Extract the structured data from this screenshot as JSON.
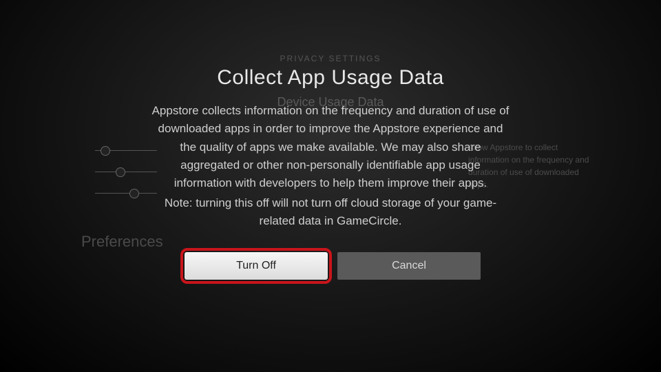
{
  "background": {
    "breadcrumb": "PRIVACY SETTINGS",
    "section_title": "Device Usage Data",
    "menu_label": "Preferences",
    "side_description": "Allow Appstore to collect information on the frequency and duration of use of downloaded apps."
  },
  "modal": {
    "title": "Collect App Usage Data",
    "body_main": "Appstore collects information on the frequency and duration of use of downloaded apps in order to improve the Appstore experience and the quality of apps we make available. We may also share aggregated or other non-personally identifiable app usage information with developers to help them improve their apps.",
    "body_note": "Note: turning this off will not turn off cloud storage of your game-related data in GameCircle.",
    "primary_label": "Turn Off",
    "secondary_label": "Cancel"
  }
}
